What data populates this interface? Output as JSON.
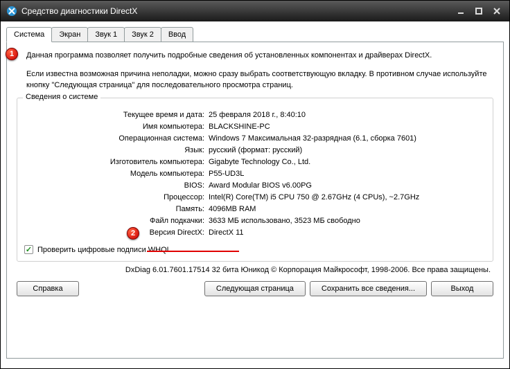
{
  "titlebar": {
    "title": "Средство диагностики DirectX"
  },
  "tabs": {
    "system": "Система",
    "display": "Экран",
    "sound1": "Звук 1",
    "sound2": "Звук 2",
    "input": "Ввод"
  },
  "description": {
    "line1": "Данная программа позволяет получить подробные сведения об установленных компонентах и драйверах DirectX.",
    "line2": "Если известна возможная причина неполадки, можно сразу выбрать соответствующую вкладку. В противном случае используйте кнопку \"Следующая страница\" для последовательного просмотра страниц."
  },
  "groupbox": {
    "title": "Сведения о системе"
  },
  "info": {
    "labels": {
      "datetime": "Текущее время и дата:",
      "computer_name": "Имя компьютера:",
      "os": "Операционная система:",
      "language": "Язык:",
      "manufacturer": "Изготовитель компьютера:",
      "model": "Модель компьютера:",
      "bios": "BIOS:",
      "processor": "Процессор:",
      "memory": "Память:",
      "pagefile": "Файл подкачки:",
      "directx_version": "Версия DirectX:"
    },
    "values": {
      "datetime": "25 февраля 2018 г., 8:40:10",
      "computer_name": "BLACKSHINE-PC",
      "os": "Windows 7 Максимальная 32-разрядная (6.1, сборка 7601)",
      "language": "русский (формат: русский)",
      "manufacturer": "Gigabyte Technology Co., Ltd.",
      "model": "P55-UD3L",
      "bios": "Award Modular BIOS v6.00PG",
      "processor": "Intel(R) Core(TM) i5 CPU         750  @ 2.67GHz (4 CPUs), ~2.7GHz",
      "memory": "4096MB RAM",
      "pagefile": "3633 МБ использовано, 3523 МБ свободно",
      "directx_version": "DirectX 11"
    }
  },
  "checkbox": {
    "label": "Проверить цифровые подписи WHQL",
    "checked": true
  },
  "footer": "DxDiag 6.01.7601.17514 32 бита Юникод © Корпорация Майкрософт, 1998-2006. Все права защищены.",
  "buttons": {
    "help": "Справка",
    "next": "Следующая страница",
    "save": "Сохранить все сведения...",
    "exit": "Выход"
  },
  "annotations": {
    "n1": "1",
    "n2": "2"
  }
}
